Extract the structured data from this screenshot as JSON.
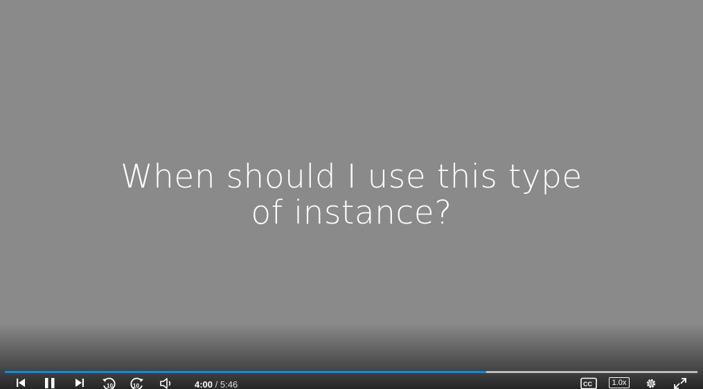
{
  "slide": {
    "title_line1": "When should I use this type",
    "title_line2": "of instance?"
  },
  "player": {
    "progress_fraction": 0.6946,
    "time": {
      "current": "4:00",
      "separator": "/",
      "duration": "5:46"
    },
    "speed_label": "1.0x",
    "colors": {
      "progress_fill": "#1e88c8",
      "progress_track": "#bdbdbd",
      "background": "#8a8a8a"
    },
    "icons": {
      "previous": "skip-previous-icon",
      "pause": "pause-icon",
      "next": "skip-next-icon",
      "rewind": "rewind-10-icon",
      "forward": "forward-10-icon",
      "volume": "volume-icon",
      "captions": "closed-captions-icon",
      "settings": "gear-icon",
      "fullscreen": "fullscreen-icon"
    }
  }
}
